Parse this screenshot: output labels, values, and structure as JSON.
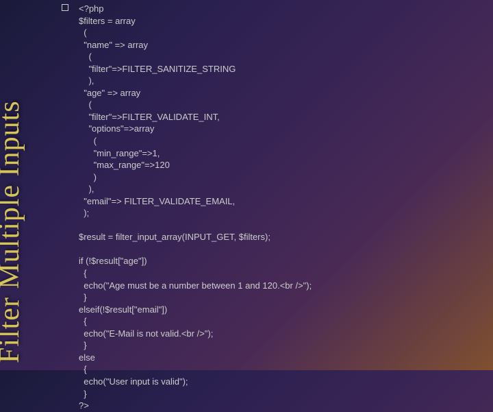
{
  "slide": {
    "title": "Filter Multiple Inputs"
  },
  "code": {
    "text": "<?php\n$filters = array\n  (\n  \"name\" => array\n    (\n    \"filter\"=>FILTER_SANITIZE_STRING\n    ),\n  \"age\" => array\n    (\n    \"filter\"=>FILTER_VALIDATE_INT,\n    \"options\"=>array\n      (\n      \"min_range\"=>1,\n      \"max_range\"=>120\n      )\n    ),\n  \"email\"=> FILTER_VALIDATE_EMAIL,\n  );\n\n$result = filter_input_array(INPUT_GET, $filters);\n\nif (!$result[\"age\"])\n  {\n  echo(\"Age must be a number between 1 and 120.<br />\");\n  }\nelseif(!$result[\"email\"])\n  {\n  echo(\"E-Mail is not valid.<br />\");\n  }\nelse\n  {\n  echo(\"User input is valid\");\n  }\n?>"
  }
}
